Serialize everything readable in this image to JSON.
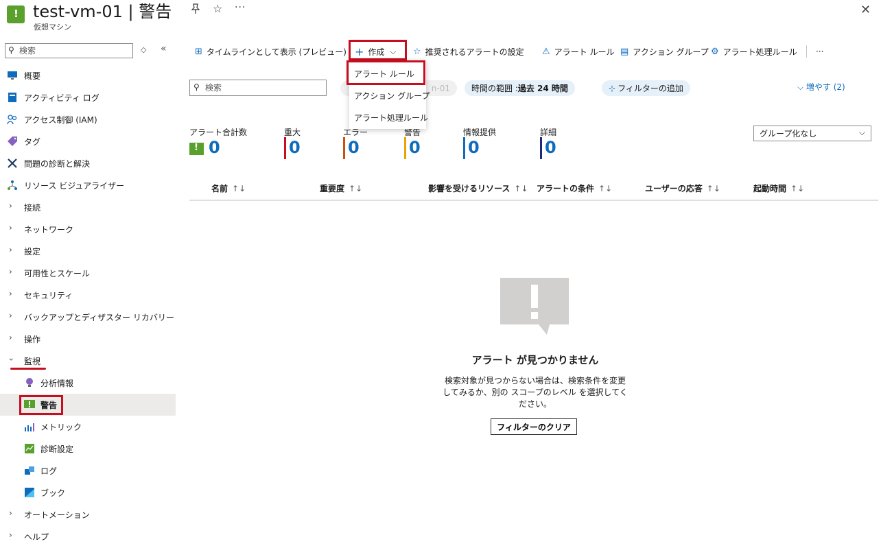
{
  "header": {
    "title": "test-vm-01 | 警告",
    "subtitle": "仮想マシン",
    "more": "···",
    "close": "✕"
  },
  "sidebar": {
    "search_placeholder": "検索",
    "items": [
      {
        "label": "概要",
        "icon": "monitor-icon"
      },
      {
        "label": "アクティビティ ログ",
        "icon": "activity-log-icon"
      },
      {
        "label": "アクセス制御 (IAM)",
        "icon": "people-icon"
      },
      {
        "label": "タグ",
        "icon": "tag-icon"
      },
      {
        "label": "問題の診断と解決",
        "icon": "wrench-icon"
      },
      {
        "label": "リソース ビジュアライザー",
        "icon": "hierarchy-icon"
      },
      {
        "label": "接続",
        "icon": "chevron-right-icon"
      },
      {
        "label": "ネットワーク",
        "icon": "chevron-right-icon"
      },
      {
        "label": "設定",
        "icon": "chevron-right-icon"
      },
      {
        "label": "可用性とスケール",
        "icon": "chevron-right-icon"
      },
      {
        "label": "セキュリティ",
        "icon": "chevron-right-icon"
      },
      {
        "label": "バックアップとディザスター リカバリー",
        "icon": "chevron-right-icon"
      },
      {
        "label": "操作",
        "icon": "chevron-right-icon"
      },
      {
        "label": "監視",
        "icon": "chevron-down-icon",
        "expanded": true
      },
      {
        "label": "分析情報",
        "icon": "bulb-icon"
      },
      {
        "label": "警告",
        "icon": "alert-icon",
        "active": true
      },
      {
        "label": "メトリック",
        "icon": "metrics-icon"
      },
      {
        "label": "診断設定",
        "icon": "diagnostic-icon"
      },
      {
        "label": "ログ",
        "icon": "logs-icon"
      },
      {
        "label": "ブック",
        "icon": "workbook-icon"
      },
      {
        "label": "オートメーション",
        "icon": "chevron-right-icon"
      },
      {
        "label": "ヘルプ",
        "icon": "chevron-right-icon"
      }
    ]
  },
  "toolbar": {
    "timeline": "タイムラインとして表示 (プレビュー)",
    "create": "作成",
    "recommended": "推奨されるアラートの設定",
    "alert_rules": "アラート ルール",
    "action_groups": "アクション グループ",
    "processing_rules": "アラート処理ルール",
    "more": "···"
  },
  "create_menu": {
    "items": [
      "アラート ルール",
      "アクション グループ",
      "アラート処理ルール"
    ]
  },
  "filters": {
    "search_placeholder": "検索",
    "scope_pill": "n-01",
    "time_range_label": "時間の範囲 : ",
    "time_range_value": "過去 24 時間",
    "add_filter": "フィルターの追加",
    "expand": "増やす (2)"
  },
  "summary": [
    {
      "label": "アラート合計数",
      "value": "0"
    },
    {
      "label": "重大",
      "value": "0",
      "color": "#c50f1f"
    },
    {
      "label": "エラー",
      "value": "0",
      "color": "#ca5010"
    },
    {
      "label": "警告",
      "value": "0",
      "color": "#eaa300"
    },
    {
      "label": "情報提供",
      "value": "0",
      "color": "#0f6cbd"
    },
    {
      "label": "詳細",
      "value": "0",
      "color": "#1a2a78"
    }
  ],
  "group_by": {
    "selected": "グループ化なし"
  },
  "table": {
    "columns": [
      "名前",
      "重要度",
      "影響を受けるリソース",
      "アラートの条件",
      "ユーザーの応答",
      "起動時間"
    ]
  },
  "empty_state": {
    "title": "アラート が見つかりません",
    "description": "検索対象が見つからない場合は、検索条件を変更してみるか、別の スコープのレベル を選択してください。",
    "button": "フィルターのクリア"
  },
  "colors": {
    "accent": "#0f6cbd",
    "highlight": "#c50f1f",
    "resource_green": "#5aa02c"
  }
}
